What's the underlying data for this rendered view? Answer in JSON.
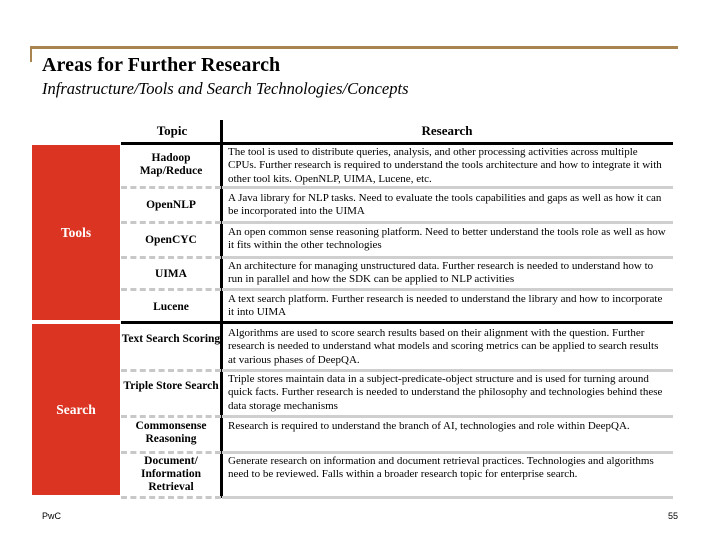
{
  "header": {
    "title": "Areas for Further Research",
    "subtitle": "Infrastructure/Tools and Search Technologies/Concepts"
  },
  "table": {
    "columns": {
      "topic": "Topic",
      "research": "Research"
    },
    "groups": [
      {
        "label": "Tools",
        "rows": [
          {
            "topic": "Hadoop Map/Reduce",
            "research": "The tool is used to distribute queries, analysis, and other processing activities across multiple CPUs.  Further research is required to understand the tools architecture and how to integrate it with other tool kits. OpenNLP, UIMA, Lucene, etc."
          },
          {
            "topic": "OpenNLP",
            "research": "A Java library for NLP tasks. Need to evaluate the tools capabilities and gaps as well as how it can be incorporated into the UIMA"
          },
          {
            "topic": "OpenCYC",
            "research": "An open common sense reasoning platform. Need to better understand the tools role as well as how it fits within the other technologies"
          },
          {
            "topic": "UIMA",
            "research": "An architecture for managing unstructured data. Further research is needed to understand how to run in parallel and how  the SDK can be applied to NLP activities"
          },
          {
            "topic": "Lucene",
            "research": "A text search platform. Further research is needed to understand the library and how to incorporate it into UIMA"
          }
        ]
      },
      {
        "label": "Search",
        "rows": [
          {
            "topic": "Text Search Scoring",
            "research": "Algorithms are used to score search results based on their alignment with the question. Further research is needed to understand what models  and scoring metrics can be applied to search results at various phases of DeepQA."
          },
          {
            "topic": "Triple Store Search",
            "research": "Triple stores maintain data in a subject-predicate-object structure and is used for turning around quick facts. Further research is needed to understand the philosophy and technologies behind these data storage mechanisms"
          },
          {
            "topic": "Commonsense Reasoning",
            "research": "Research is required to understand the branch of AI, technologies and role within DeepQA."
          },
          {
            "topic": "Document/ Information Retrieval",
            "research": "Generate research on information and document retrieval practices. Technologies and algorithms need to be reviewed. Falls within a broader research topic for enterprise search."
          }
        ]
      }
    ]
  },
  "footer": {
    "company": "PwC",
    "page_number": "55"
  },
  "colors": {
    "accent_rule": "#a8844e",
    "group_block": "#dc3422"
  }
}
